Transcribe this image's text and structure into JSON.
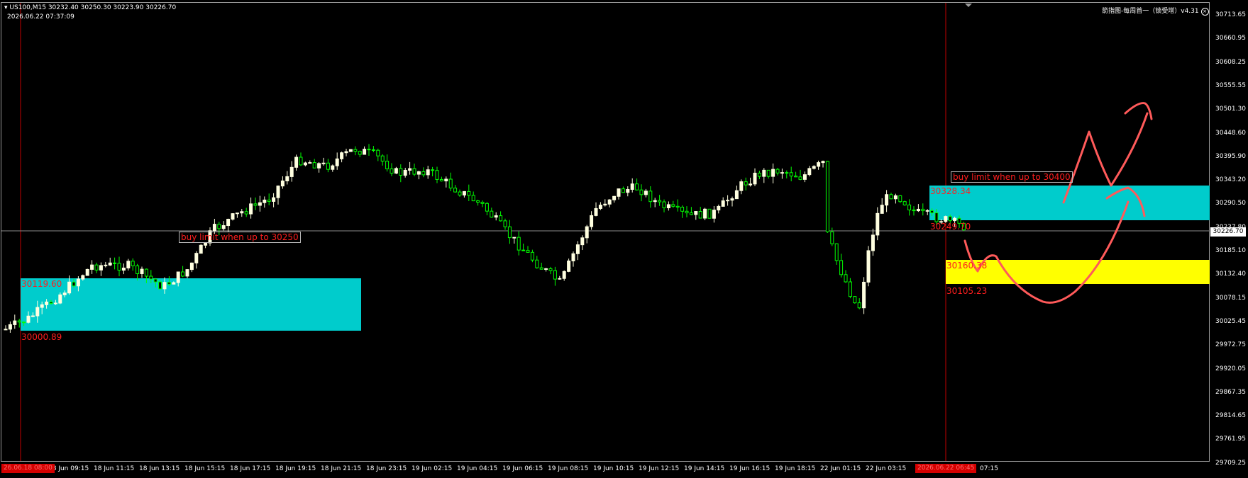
{
  "header": {
    "symbol_line": "US100,M15  30232.40 30250.30 30223.90 30226.70",
    "datetime": "2026.06.22 07:37:09",
    "indicator_label": "箭指图-每周首一（锁受增）v4.31"
  },
  "price_axis": {
    "labels": [
      "30713.65",
      "30660.95",
      "30608.25",
      "30555.55",
      "30501.30",
      "30448.60",
      "30395.90",
      "30343.20",
      "30290.50",
      "30237.80",
      "30185.10",
      "30132.40",
      "30078.15",
      "30025.45",
      "29972.75",
      "29920.05",
      "29867.35",
      "29814.65",
      "29761.95",
      "29709.25"
    ],
    "current_price": "30226.70"
  },
  "time_axis": {
    "labels": [
      "18 Jun 09:15",
      "18 Jun 11:15",
      "18 Jun 13:15",
      "18 Jun 15:15",
      "18 Jun 17:15",
      "18 Jun 19:15",
      "18 Jun 21:15",
      "18 Jun 23:15",
      "19 Jun 02:15",
      "19 Jun 04:15",
      "19 Jun 06:15",
      "19 Jun 08:15",
      "19 Jun 10:15",
      "19 Jun 12:15",
      "19 Jun 14:15",
      "19 Jun 16:15",
      "19 Jun 18:15",
      "22 Jun 01:15",
      "22 Jun 03:15",
      "07:15"
    ],
    "left_marker": "26.06.18 08:00",
    "right_marker": "2026.06.22 06:45"
  },
  "zones": {
    "left_zone_top": "30119.60",
    "left_zone_bottom": "30000.89",
    "right_zone_top": "30328.34",
    "right_zone_bottom": "30249.70",
    "yellow_zone_top": "30160.38",
    "yellow_zone_bottom": "30105.23"
  },
  "notes": {
    "left_note": "buy limit when up to 30250",
    "right_note": "buy limit when up to 30400"
  },
  "colors": {
    "background": "#000000",
    "bull_candle": "#ffffe0",
    "bear_candle": "#00ff00",
    "zone_cyan": "#00cccc",
    "zone_yellow": "#ffff00",
    "level_text": "#ff1e1e",
    "drawing": "#ff5a5a"
  }
}
